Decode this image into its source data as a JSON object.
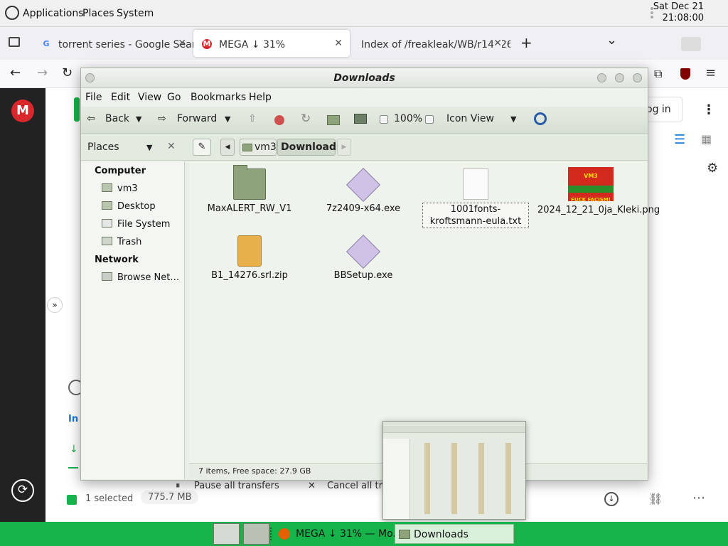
{
  "top_panel": {
    "applications": "Applications",
    "places": "Places",
    "system": "System",
    "date": "Sat Dec 21",
    "time": "21:08:00"
  },
  "browser": {
    "tabs": [
      {
        "label": "torrent series - Google Sear",
        "favicon": "G"
      },
      {
        "label": "MEGA ↓ 31%",
        "favicon": "M"
      },
      {
        "label": "Index of /freakleak/WB/r14726",
        "favicon": ""
      }
    ],
    "new_tab": "+",
    "tab_list": "⌄"
  },
  "mega": {
    "logo": "M",
    "login_label": "og in",
    "tab_letter": "In",
    "pause_label": "Pause all transfers",
    "cancel_label": "Cancel all tra",
    "selected_text": "1 selected",
    "size_text": "775.7 MB"
  },
  "file_manager": {
    "title": "Downloads",
    "menu": [
      "File",
      "Edit",
      "View",
      "Go",
      "Bookmarks",
      "Help"
    ],
    "toolbar": {
      "back": "Back",
      "forward": "Forward",
      "zoom": "100%",
      "view_mode": "Icon View"
    },
    "places_label": "Places",
    "breadcrumb": [
      "vm3",
      "Downloads"
    ],
    "sidebar": {
      "computer_header": "Computer",
      "computer_items": [
        "vm3",
        "Desktop",
        "File System",
        "Trash"
      ],
      "network_header": "Network",
      "network_items": [
        "Browse Net…"
      ]
    },
    "files": [
      {
        "name": "MaxALERT_RW_V1",
        "type": "folder"
      },
      {
        "name": "7z2409-x64.exe",
        "type": "exe"
      },
      {
        "name": "1001fonts-kroftsmann-eula.txt",
        "type": "txt",
        "selected": true
      },
      {
        "name": "2024_12_21_0ja_Kleki.png",
        "type": "png"
      },
      {
        "name": "B1_14276.srl.zip",
        "type": "zip"
      },
      {
        "name": "BBSetup.exe",
        "type": "exe"
      }
    ],
    "png_thumb_text_top": "VM3",
    "png_thumb_text_bottom": "FUCK FACISM!",
    "status": "7 items, Free space: 27.9 GB"
  },
  "taskbar": {
    "firefox_task": "MEGA ↓ 31% — Mo...",
    "files_task": "Downloads"
  },
  "colors": {
    "taskbar_green": "#16b24a",
    "mega_red": "#d9272e",
    "fm_bg": "#e9efe7"
  }
}
